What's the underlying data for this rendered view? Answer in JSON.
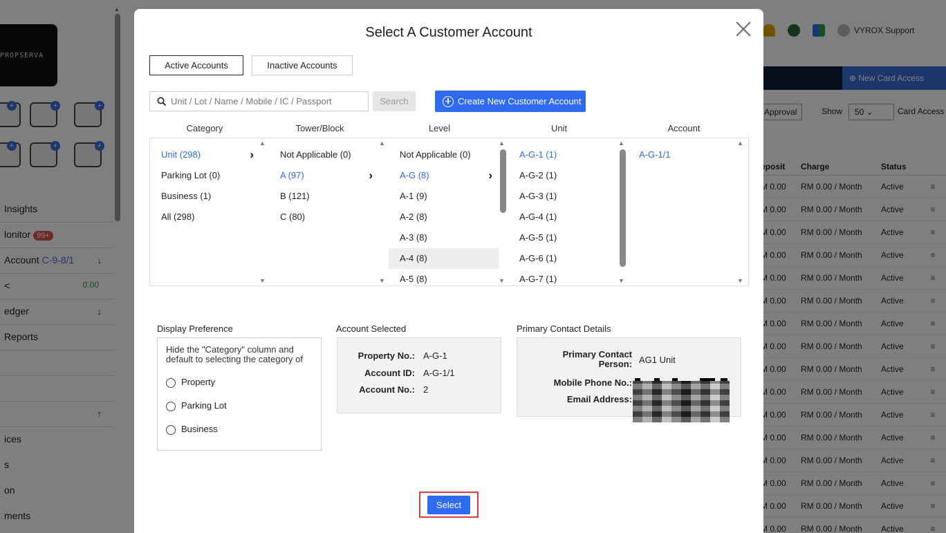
{
  "background": {
    "logo_text": "PROPSERVA",
    "sidebar": [
      {
        "label": "Insights",
        "badge": null,
        "extra": null,
        "arrow": null
      },
      {
        "label": "lonitor",
        "badge": "99+",
        "extra": null,
        "arrow": null
      },
      {
        "label": "Account",
        "badge": null,
        "extra": "C-9-8/1",
        "arrow": "↓"
      },
      {
        "label": "<",
        "badge": null,
        "extra": "0.00",
        "arrow": null
      },
      {
        "label": "edger",
        "badge": null,
        "extra": null,
        "arrow": "↓"
      },
      {
        "label": "Reports",
        "badge": null,
        "extra": null,
        "arrow": null
      },
      {
        "label": "",
        "badge": null,
        "extra": null,
        "arrow": null
      },
      {
        "label": "",
        "badge": null,
        "extra": null,
        "arrow": null
      },
      {
        "label": "",
        "badge": null,
        "extra": null,
        "arrow": "↑"
      },
      {
        "label": "ices",
        "badge": null,
        "extra": null,
        "arrow": null
      },
      {
        "label": "s",
        "badge": null,
        "extra": null,
        "arrow": null
      },
      {
        "label": "on",
        "badge": null,
        "extra": null,
        "arrow": null
      },
      {
        "label": "ments",
        "badge": null,
        "extra": null,
        "arrow": null
      }
    ],
    "header_user": "VYROX Support",
    "new_card_access": "New Card Access",
    "approval": "Approval",
    "show_label": "Show",
    "show_value": "50",
    "card_access_label": "Card Access",
    "table": {
      "headers": [
        "eposit",
        "Charge",
        "Status",
        ""
      ],
      "rows": [
        [
          "M 0.00",
          "RM 0.00 / Month",
          "Active",
          "≡"
        ],
        [
          "M 0.00",
          "RM 0.00 / Month",
          "Active",
          "≡"
        ],
        [
          "M 0.00",
          "RM 0.00 / Month",
          "Active",
          "≡"
        ],
        [
          "M 0.00",
          "RM 0.00 / Month",
          "Active",
          "≡"
        ],
        [
          "M 0.00",
          "RM 0.00 / Month",
          "Active",
          "≡"
        ],
        [
          "M 0.00",
          "RM 0.00 / Month",
          "Active",
          "≡"
        ],
        [
          "M 0.00",
          "RM 0.00 / Month",
          "Active",
          "≡"
        ],
        [
          "M 0.00",
          "RM 0.00 / Month",
          "Active",
          "≡"
        ],
        [
          "M 0.00",
          "RM 0.00 / Month",
          "Active",
          "≡"
        ],
        [
          "M 0.00",
          "RM 0.00 / Month",
          "Active",
          "≡"
        ],
        [
          "M 0.00",
          "RM 0.00 / Month",
          "Active",
          "≡"
        ],
        [
          "M 0.00",
          "RM 0.00 / Month",
          "Active",
          "≡"
        ],
        [
          "M 0.00",
          "RM 0.00 / Month",
          "Active",
          "≡"
        ],
        [
          "M 0.00",
          "RM 0.00 / Month",
          "Active",
          "≡"
        ],
        [
          "M 0.00",
          "RM 0.00 / Month",
          "Active",
          "≡"
        ],
        [
          "M 0.00",
          "RM 0.00 / Month",
          "Active",
          "≡"
        ]
      ]
    }
  },
  "modal": {
    "title": "Select A Customer Account",
    "tabs": {
      "active": "Active Accounts",
      "inactive": "Inactive Accounts"
    },
    "search": {
      "placeholder": "Unit / Lot / Name / Mobile / IC / Passport",
      "button": "Search"
    },
    "create_button": "Create New Customer Account",
    "columns": {
      "category": {
        "header": "Category",
        "items": [
          "Unit (298)",
          "Parking Lot (0)",
          "Business (1)",
          "All (298)"
        ],
        "selected": 0
      },
      "tower": {
        "header": "Tower/Block",
        "items": [
          "Not Applicable (0)",
          "A (97)",
          "B (121)",
          "C (80)"
        ],
        "selected": 1
      },
      "level": {
        "header": "Level",
        "items": [
          "Not Applicable (0)",
          "A-G (8)",
          "A-1 (9)",
          "A-2 (8)",
          "A-3 (8)",
          "A-4 (8)",
          "A-5 (8)"
        ],
        "selected": 1,
        "hovered": 5
      },
      "unit": {
        "header": "Unit",
        "items": [
          "A-G-1 (1)",
          "A-G-2 (1)",
          "A-G-3 (1)",
          "A-G-4 (1)",
          "A-G-5 (1)",
          "A-G-6 (1)",
          "A-G-7 (1)"
        ],
        "selected": 0
      },
      "account": {
        "header": "Account",
        "items": [
          "A-G-1/1"
        ],
        "selected": 0
      }
    },
    "display_preference": {
      "label": "Display Preference",
      "text": "Hide the \"Category\" column and default to selecting the category of",
      "options": [
        "Property",
        "Parking Lot",
        "Business"
      ]
    },
    "account_selected": {
      "label": "Account Selected",
      "property_no_label": "Property No.:",
      "property_no": "A-G-1",
      "account_id_label": "Account ID:",
      "account_id": "A-G-1/1",
      "account_no_label": "Account No.:",
      "account_no": "2"
    },
    "primary_contact": {
      "label": "Primary Contact Details",
      "person_label": "Primary Contact Person:",
      "person": "AG1 Unit",
      "mobile_label": "Mobile Phone No.:",
      "email_label": "Email Address:"
    },
    "select_button": "Select"
  }
}
